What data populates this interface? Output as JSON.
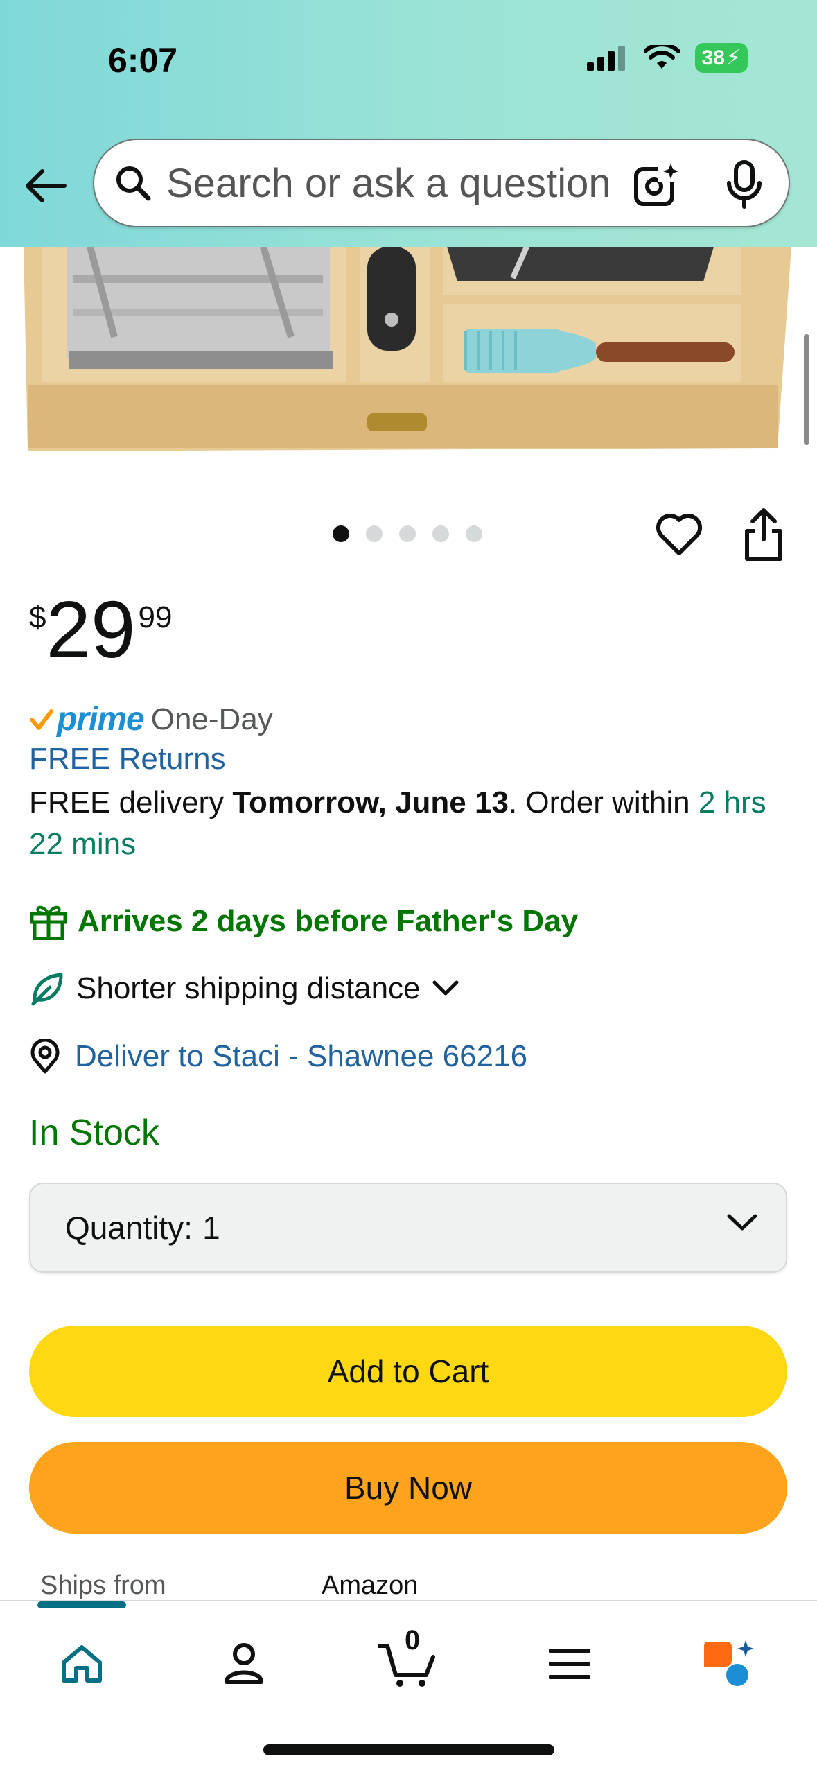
{
  "status_bar": {
    "time": "6:07",
    "battery": "38"
  },
  "search": {
    "placeholder": "Search or ask a question"
  },
  "carousel": {
    "total_images": 5,
    "active_index": 0
  },
  "price": {
    "currency": "$",
    "whole": "29",
    "fraction": "99"
  },
  "prime": {
    "label": "prime",
    "speed": "One-Day"
  },
  "returns": {
    "label": "FREE Returns"
  },
  "delivery": {
    "prefix": "FREE delivery ",
    "date": "Tomorrow, June 13",
    "middle": ". Order within ",
    "countdown": "2 hrs 22 mins"
  },
  "gift": {
    "text": "Arrives 2 days before Father's Day"
  },
  "shipping": {
    "text": "Shorter shipping distance"
  },
  "location": {
    "text": "Deliver to Staci - Shawnee 66216"
  },
  "stock": {
    "text": "In Stock"
  },
  "quantity": {
    "label": "Quantity:",
    "value": "1"
  },
  "buttons": {
    "add_to_cart": "Add to Cart",
    "buy_now": "Buy Now"
  },
  "ships_from": {
    "label": "Ships from",
    "value": "Amazon"
  },
  "tabbar": {
    "items": [
      "home-icon",
      "account-icon",
      "cart-icon",
      "menu-icon",
      "rufus-icon"
    ],
    "cart_count": "0"
  },
  "colors": {
    "header_gradient": [
      "#7fd8d8",
      "#a4e6d3"
    ],
    "add_to_cart": "#ffd814",
    "buy_now": "#ffa41c",
    "link": "#2162a1",
    "success": "#007600",
    "countdown": "#067d62",
    "active_tab": "#007185"
  }
}
